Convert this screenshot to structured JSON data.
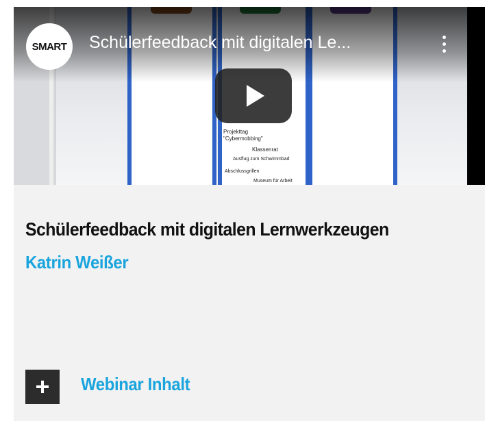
{
  "video": {
    "channel_logo_text": "SMART",
    "title": "Schülerfeedback mit digitalen Le...",
    "play_icon": "play-icon",
    "menu_icon": "more-vert-icon",
    "thumbnail_text": {
      "line1": "Projekttag",
      "line2": "\"Cybermobbing\"",
      "line3": "Klassenrat",
      "line4": "Ausflug zum Schwimmbad",
      "line5": "Abschlussgrillen",
      "line6": "Museum für Arbeit"
    }
  },
  "card": {
    "title": "Schülerfeedback mit digitalen Lernwerkzeugen",
    "author": "Katrin Weißer",
    "accordion_label": "Webinar Inhalt",
    "accordion_icon": "plus-icon"
  },
  "colors": {
    "accent": "#1aa4dd",
    "card_bg": "#f2f2f2",
    "button_bg": "#2c2c2c"
  }
}
